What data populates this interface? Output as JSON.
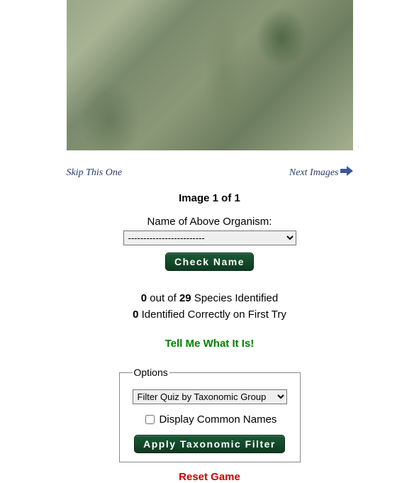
{
  "nav": {
    "skip_label": "Skip This One",
    "next_label": "Next Images"
  },
  "counter": {
    "text": "Image 1 of 1"
  },
  "form": {
    "name_label": "Name of Above Organism:",
    "organism_selected": "-------------------------",
    "check_button": "Check Name"
  },
  "score": {
    "identified_count": "0",
    "out_of_text": " out of ",
    "total_species": "29",
    "identified_suffix": " Species Identified",
    "correct_count": "0",
    "correct_suffix": " Identified Correctly on First Try"
  },
  "tell_me_label": "Tell Me What It Is!",
  "options": {
    "legend": "Options",
    "taxon_selected": "Filter Quiz by Taxonomic Group",
    "common_names_label": "Display Common Names",
    "apply_button": "Apply Taxonomic Filter"
  },
  "reset_label": "Reset Game"
}
